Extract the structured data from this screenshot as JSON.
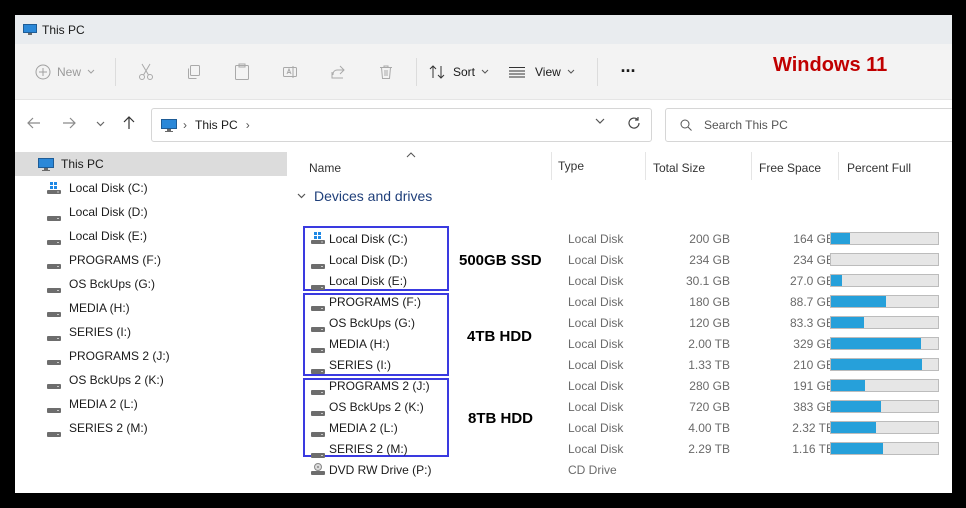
{
  "window": {
    "title": "This PC"
  },
  "toolbar": {
    "new_label": "New",
    "sort_label": "Sort",
    "view_label": "View",
    "more_label": "···",
    "annotation": "Windows 11"
  },
  "address": {
    "crumb": "This PC",
    "sep": "›"
  },
  "search": {
    "placeholder": "Search This PC"
  },
  "sidebar": {
    "items": [
      {
        "label": "This PC",
        "icon": "monitor-icon"
      },
      {
        "label": "Local Disk (C:)",
        "icon": "windows-drive-icon"
      },
      {
        "label": "Local Disk (D:)",
        "icon": "drive-icon"
      },
      {
        "label": "Local Disk (E:)",
        "icon": "drive-icon"
      },
      {
        "label": "PROGRAMS (F:)",
        "icon": "drive-icon"
      },
      {
        "label": "OS BckUps (G:)",
        "icon": "drive-icon"
      },
      {
        "label": "MEDIA (H:)",
        "icon": "drive-icon"
      },
      {
        "label": "SERIES (I:)",
        "icon": "drive-icon"
      },
      {
        "label": "PROGRAMS 2 (J:)",
        "icon": "drive-icon"
      },
      {
        "label": "OS BckUps 2 (K:)",
        "icon": "drive-icon"
      },
      {
        "label": "MEDIA 2 (L:)",
        "icon": "drive-icon"
      },
      {
        "label": "SERIES 2 (M:)",
        "icon": "drive-icon"
      }
    ]
  },
  "columns": {
    "name": "Name",
    "type": "Type",
    "total": "Total Size",
    "free": "Free Space",
    "percent": "Percent Full"
  },
  "group": {
    "title": "Devices and drives"
  },
  "drives": [
    {
      "name": "Local Disk (C:)",
      "type": "Local Disk",
      "total": "200 GB",
      "free": "164 GB",
      "pct": 18,
      "icon": "windows-drive-icon"
    },
    {
      "name": "Local Disk (D:)",
      "type": "Local Disk",
      "total": "234 GB",
      "free": "234 GB",
      "pct": 0,
      "icon": "drive-icon"
    },
    {
      "name": "Local Disk (E:)",
      "type": "Local Disk",
      "total": "30.1 GB",
      "free": "27.0 GB",
      "pct": 10,
      "icon": "drive-icon"
    },
    {
      "name": "PROGRAMS (F:)",
      "type": "Local Disk",
      "total": "180 GB",
      "free": "88.7 GB",
      "pct": 51,
      "icon": "drive-icon"
    },
    {
      "name": "OS BckUps (G:)",
      "type": "Local Disk",
      "total": "120 GB",
      "free": "83.3 GB",
      "pct": 31,
      "icon": "drive-icon"
    },
    {
      "name": "MEDIA (H:)",
      "type": "Local Disk",
      "total": "2.00 TB",
      "free": "329 GB",
      "pct": 84,
      "icon": "drive-icon"
    },
    {
      "name": "SERIES (I:)",
      "type": "Local Disk",
      "total": "1.33 TB",
      "free": "210 GB",
      "pct": 85,
      "icon": "drive-icon"
    },
    {
      "name": "PROGRAMS 2 (J:)",
      "type": "Local Disk",
      "total": "280 GB",
      "free": "191 GB",
      "pct": 32,
      "icon": "drive-icon"
    },
    {
      "name": "OS BckUps 2 (K:)",
      "type": "Local Disk",
      "total": "720 GB",
      "free": "383 GB",
      "pct": 47,
      "icon": "drive-icon"
    },
    {
      "name": "MEDIA 2 (L:)",
      "type": "Local Disk",
      "total": "4.00 TB",
      "free": "2.32 TB",
      "pct": 42,
      "icon": "drive-icon"
    },
    {
      "name": "SERIES 2 (M:)",
      "type": "Local Disk",
      "total": "2.29 TB",
      "free": "1.16 TB",
      "pct": 49,
      "icon": "drive-icon"
    },
    {
      "name": "DVD RW Drive (P:)",
      "type": "CD Drive",
      "total": "",
      "free": "",
      "pct": null,
      "icon": "dvd-drive-icon"
    }
  ],
  "annotations": [
    {
      "label": "500GB SSD"
    },
    {
      "label": "4TB HDD"
    },
    {
      "label": "8TB HDD"
    }
  ],
  "colors": {
    "accent": "#26a0da",
    "annotation_box": "#3a3ae0",
    "annotation_title": "#c00000"
  }
}
